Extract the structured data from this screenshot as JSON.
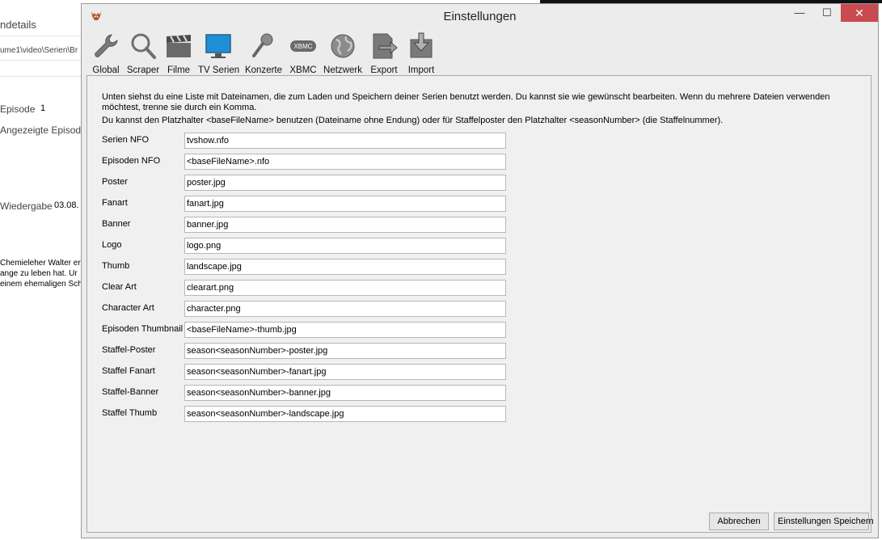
{
  "background": {
    "texts": [
      "ndetails",
      "ume1\\video\\Serien\\Br",
      "Episode",
      "1",
      "Angezeigte Episode",
      "Wiedergabe",
      "03.08.",
      "Chemieleher Walter er",
      "ange zu leben hat. Ur",
      "einem ehemaligen Sch"
    ]
  },
  "dialog": {
    "title": "Einstellungen",
    "window_buttons": {
      "minimize": "—",
      "maximize": "☐",
      "close": "✕"
    }
  },
  "toolbar": {
    "items": [
      {
        "label": "Global",
        "icon": "wrench-icon"
      },
      {
        "label": "Scraper",
        "icon": "magnifier-icon"
      },
      {
        "label": "Filme",
        "icon": "clapperboard-icon"
      },
      {
        "label": "TV Serien",
        "icon": "monitor-icon"
      },
      {
        "label": "Konzerte",
        "icon": "microphone-icon"
      },
      {
        "label": "XBMC",
        "icon": "xbmc-icon",
        "icon_text": "XBMC"
      },
      {
        "label": "Netzwerk",
        "icon": "globe-icon"
      },
      {
        "label": "Export",
        "icon": "export-icon"
      },
      {
        "label": "Import",
        "icon": "import-icon"
      }
    ],
    "active": "TV Serien"
  },
  "content": {
    "intro_line1": "Unten siehst du eine Liste mit Dateinamen, die zum Laden und Speichern deiner Serien benutzt werden. Du kannst sie wie gewünscht bearbeiten. Wenn du mehrere Dateien verwenden möchtest, trenne sie durch ein Komma.",
    "intro_line2": "Du kannst den Platzhalter <baseFileName> benutzen (Dateiname ohne Endung) oder für Staffelposter den Platzhalter <seasonNumber> (die Staffelnummer).",
    "fields": [
      {
        "label": "Serien NFO",
        "value": "tvshow.nfo"
      },
      {
        "label": "Episoden NFO",
        "value": "<baseFileName>.nfo"
      },
      {
        "label": "Poster",
        "value": "poster.jpg"
      },
      {
        "label": "Fanart",
        "value": "fanart.jpg"
      },
      {
        "label": "Banner",
        "value": "banner.jpg"
      },
      {
        "label": "Logo",
        "value": "logo.png"
      },
      {
        "label": "Thumb",
        "value": "landscape.jpg"
      },
      {
        "label": "Clear Art",
        "value": "clearart.png"
      },
      {
        "label": "Character Art",
        "value": "character.png"
      },
      {
        "label": "Episoden Thumbnail",
        "value": "<baseFileName>-thumb.jpg"
      },
      {
        "label": "Staffel-Poster",
        "value": "season<seasonNumber>-poster.jpg"
      },
      {
        "label": "Staffel Fanart",
        "value": "season<seasonNumber>-fanart.jpg"
      },
      {
        "label": "Staffel-Banner",
        "value": "season<seasonNumber>-banner.jpg"
      },
      {
        "label": "Staffel Thumb",
        "value": "season<seasonNumber>-landscape.jpg"
      }
    ]
  },
  "buttons": {
    "cancel": "Abbrechen",
    "save": "Einstellungen Speichern"
  },
  "colors": {
    "dialog_bg": "#ececec",
    "panel_bg": "#f0f0f0",
    "close_button": "#c74b50",
    "monitor_blue": "#1e8fd6"
  }
}
